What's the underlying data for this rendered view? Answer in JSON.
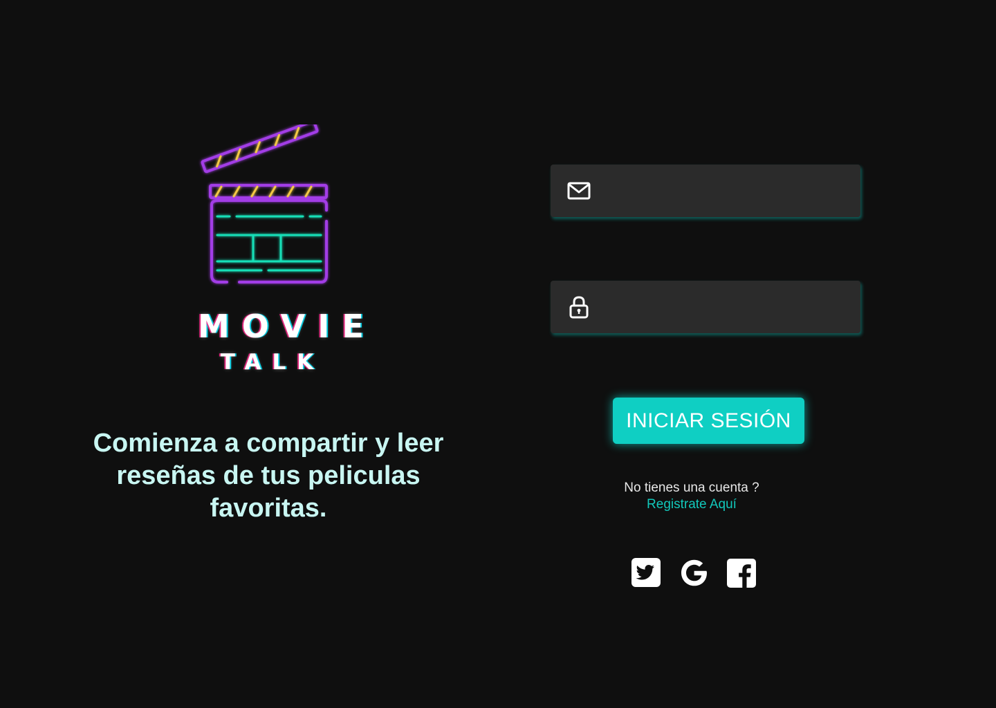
{
  "logo": {
    "word1": "MOVIE",
    "word2": "TALK",
    "clapper_colors": {
      "frame": "#a23ce6",
      "accent": "#f2c744",
      "lines": "#18e0b8"
    }
  },
  "tagline": "Comienza a compartir y leer reseñas de tus peliculas favoritas.",
  "login_form": {
    "email": {
      "icon": "mail-icon",
      "value": "",
      "placeholder": ""
    },
    "password": {
      "icon": "lock-icon",
      "value": "",
      "placeholder": ""
    },
    "submit_label": "INICIAR SESIÓN"
  },
  "register": {
    "question": "No tienes una cuenta ?",
    "link_label": "Registrate Aquí"
  },
  "social": [
    {
      "name": "twitter",
      "icon": "twitter-icon"
    },
    {
      "name": "google",
      "icon": "google-icon"
    },
    {
      "name": "facebook",
      "icon": "facebook-icon"
    }
  ],
  "colors": {
    "background": "#0f0f0f",
    "field_bg": "#2b2b2b",
    "accent_teal": "#0fcfc3",
    "tagline": "#c8f6f2"
  }
}
